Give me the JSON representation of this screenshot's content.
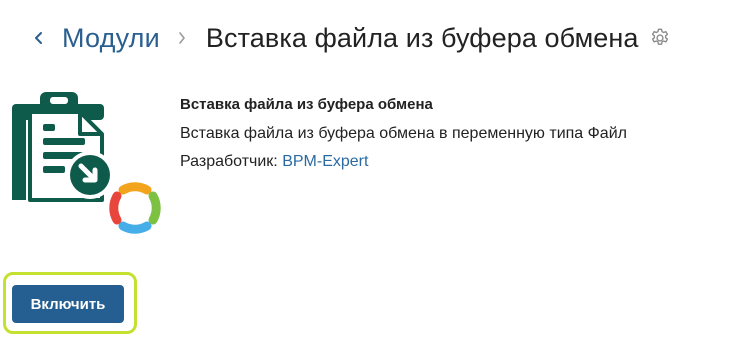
{
  "header": {
    "breadcrumb_modules": "Модули",
    "title": "Вставка файла из буфера обмена"
  },
  "module": {
    "name": "Вставка файла из буфера обмена",
    "description": "Вставка файла из буфера обмена в переменную типа Файл",
    "developer_label": "Разработчик:",
    "developer_name": "BPM-Expert"
  },
  "actions": {
    "enable_label": "Включить"
  },
  "icons": {
    "back": "chevron-left-icon",
    "separator": "chevron-right-icon",
    "settings": "gear-icon",
    "module": "clipboard-download-icon"
  },
  "colors": {
    "link": "#2a5f8f",
    "button": "#255f91",
    "icon_green": "#0f5b4b",
    "highlight": "#c4e030"
  }
}
